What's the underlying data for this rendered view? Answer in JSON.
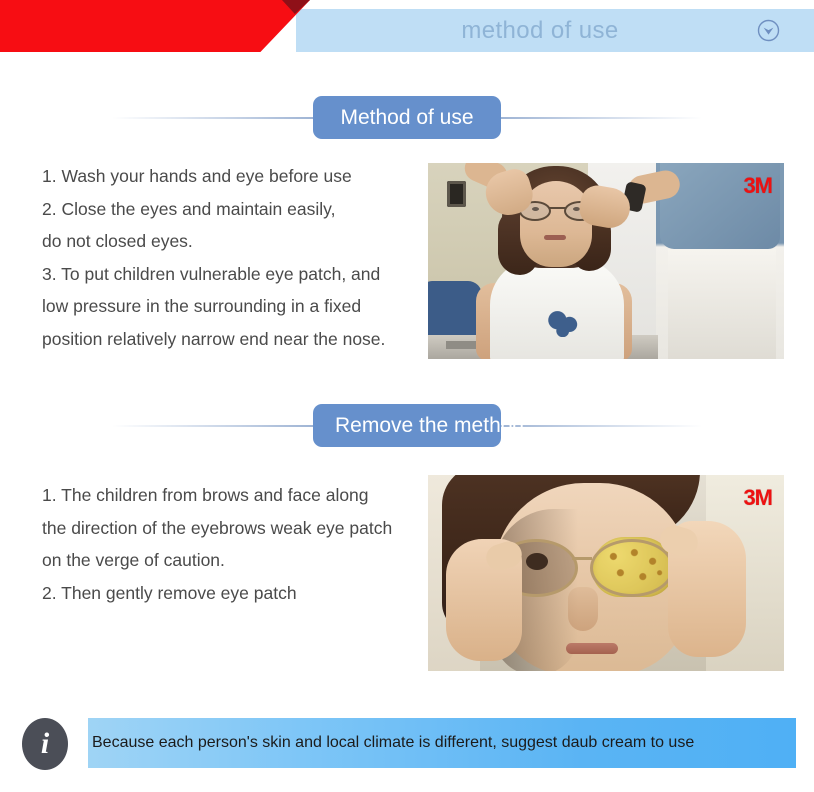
{
  "header": {
    "title": "method of use",
    "chevron_icon": "chevron-down-circle-icon",
    "band_color": "#bfdef5",
    "accent_color": "#f70d13",
    "title_color": "#8fb4d6"
  },
  "sections": [
    {
      "badge": "Method of use",
      "lines": [
        "1. Wash your hands and eye before use",
        "2. Close the eyes and maintain easily,",
        "do not closed eyes.",
        "3. To put children vulnerable eye patch, and",
        "low pressure in the surrounding in a fixed",
        "position relatively narrow end near the nose."
      ],
      "photo_watermark": "3M",
      "photo_alt": "child-being-fitted-with-glasses"
    },
    {
      "badge": "Remove the method",
      "lines": [
        "1. The children from brows and face along",
        "the direction of the eyebrows weak eye patch",
        "on the verge of caution.",
        "2. Then gently remove eye patch"
      ],
      "photo_watermark": "3M",
      "photo_alt": "child-wearing-eye-patch-closeup"
    }
  ],
  "notice": {
    "icon": "info-icon",
    "icon_glyph": "i",
    "text": "Because each person's skin and local climate is different, suggest daub cream to use",
    "bar_color_start": "#9fd4f5",
    "bar_color_end": "#4fb0f5",
    "icon_color": "#4b4e57"
  },
  "theme": {
    "badge_color": "#6690cc",
    "body_text_color": "#4a4a4a"
  }
}
